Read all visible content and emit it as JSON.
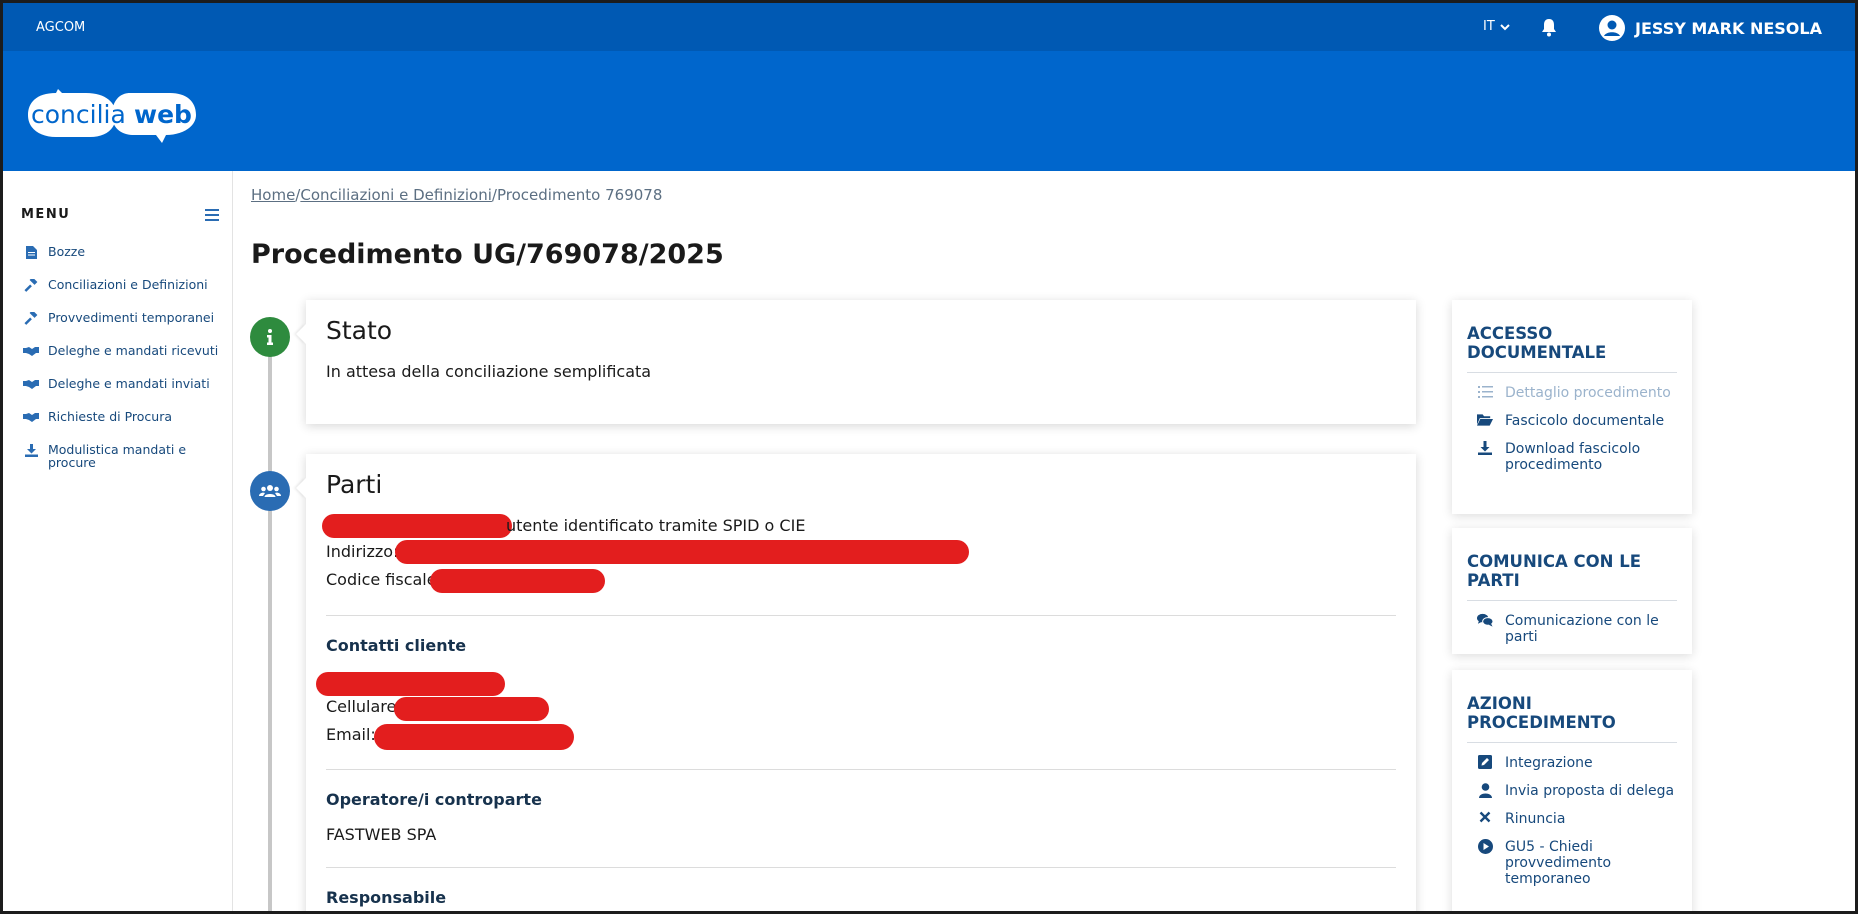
{
  "topbar": {
    "brand": "AGCOM",
    "lang": "IT",
    "user": "JESSY MARK NESOLA"
  },
  "logo": {
    "text_left": "concilia",
    "text_right": "web"
  },
  "sidebar": {
    "title": "MENU",
    "items": [
      {
        "label": "Bozze",
        "icon": "file-icon"
      },
      {
        "label": "Conciliazioni e Definizioni",
        "icon": "gavel-icon"
      },
      {
        "label": "Provvedimenti temporanei",
        "icon": "gavel-icon"
      },
      {
        "label": "Deleghe e mandati ricevuti",
        "icon": "handshake-icon"
      },
      {
        "label": "Deleghe e mandati inviati",
        "icon": "handshake-icon"
      },
      {
        "label": "Richieste di Procura",
        "icon": "handshake-icon"
      },
      {
        "label": "Modulistica mandati e procure",
        "icon": "download-icon"
      }
    ]
  },
  "breadcrumb": {
    "home": "Home",
    "section": "Conciliazioni e Definizioni",
    "current": "Procedimento 769078",
    "sep": "/"
  },
  "page": {
    "title": "Procedimento UG/769078/2025"
  },
  "stato": {
    "title": "Stato",
    "text": "In attesa della conciliazione semplificata"
  },
  "parti": {
    "title": "Parti",
    "identified": "utente identificato tramite SPID o CIE",
    "address_label": "Indirizzo:",
    "cf_label": "Codice fiscale:",
    "contacts_title": "Contatti cliente",
    "cell_label": "Cellulare:",
    "email_label": "Email:",
    "operator_title": "Operatore/i controparte",
    "operator_name": "FASTWEB SPA",
    "responsible_title": "Responsabile"
  },
  "panels": {
    "accesso": {
      "title": "ACCESSO DOCUMENTALE",
      "links": [
        "Dettaglio procedimento",
        "Fascicolo documentale",
        "Download fascicolo procedimento"
      ]
    },
    "comunica": {
      "title": "COMUNICA CON LE PARTI",
      "links": [
        "Comunicazione con le parti"
      ]
    },
    "azioni": {
      "title": "AZIONI PROCEDIMENTO",
      "links": [
        "Integrazione",
        "Invia proposta di delega",
        "Rinuncia",
        "GU5 - Chiedi provvedimento temporaneo"
      ]
    }
  },
  "colors": {
    "topbar": "#0059b3",
    "header": "#0066cc",
    "link": "#17497c",
    "success": "#2e8b3e",
    "redaction": "#e31e1e"
  }
}
